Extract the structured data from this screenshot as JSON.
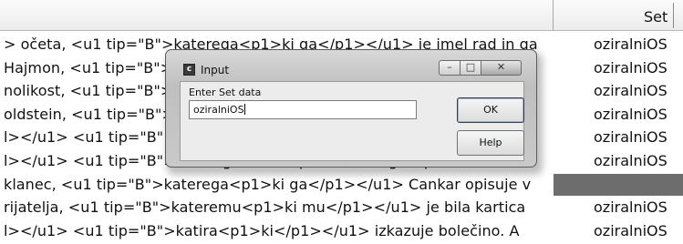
{
  "table": {
    "header_set": "Set",
    "rows": [
      {
        "text": "> očeta, <u1 tip=\"B\">katerega<p1>ki ga</p1></u1> je imel rad in ga",
        "set": "oziralniOS"
      },
      {
        "text": "Hajmon, <u1 tip=\"B\">kateremu<p1>ki mu</p1></u1> tudi zaradi",
        "set": "oziralniOS"
      },
      {
        "text": "nolikost, <u1 tip=\"B\">katere<p1>ki je</p1></u1> ne",
        "set": "oziralniOS"
      },
      {
        "text": "oldstein, <u1 tip=\"B\">katerega<p1>ki ga</p1></u1>",
        "set": "oziralniOS"
      },
      {
        "text": "l></u1> <u1 tip=\"B\">katerih<p1>ki jih</p1></u1>",
        "set": "oziralniOS"
      },
      {
        "text": "l></u1> <u1 tip=\"B\">katerega so ss <p1>ki so ss ga</p1></u1> ve.",
        "set": "oziralniOS"
      },
      {
        "text": "klanec, <u1 tip=\"B\">katerega<p1>ki ga</p1></u1> Cankar opisuje v",
        "set": ""
      },
      {
        "text": "rijatelja, <u1 tip=\"B\">kateremu<p1>ki mu</p1></u1> je bila kartica",
        "set": "oziralniOS"
      },
      {
        "text": "l></u1> <u1 tip=\"B\">katira<p1>ki</p1></u1> izkazuje bolečino. A",
        "set": "oziralniOS"
      }
    ]
  },
  "dialog": {
    "title": "Input",
    "app_icon_letter": "c",
    "prompt": "Enter Set data",
    "input_value": "oziralniOS",
    "ok_label": "OK",
    "help_label": "Help",
    "minimize_glyph": "–",
    "maximize_glyph": "□",
    "close_glyph": "✕"
  }
}
